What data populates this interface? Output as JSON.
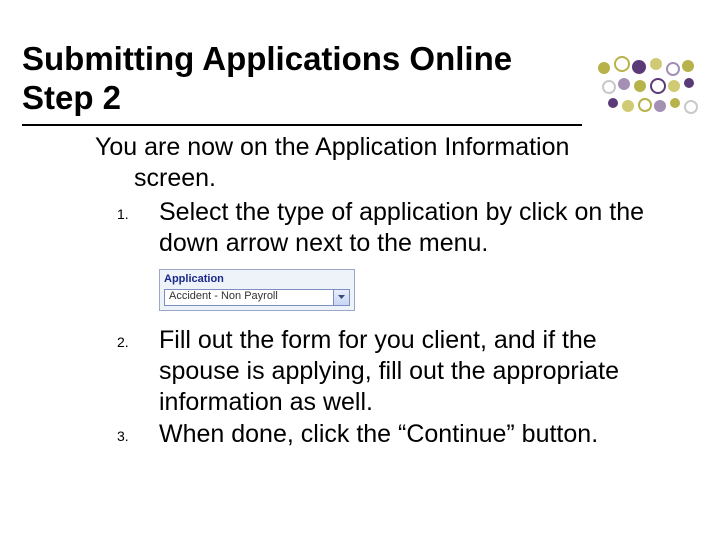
{
  "title": "Submitting Applications Online Step 2",
  "intro": "You are now on the Application Information screen.",
  "items": [
    {
      "num": "1.",
      "text": "Select the type of application by click on the down arrow next to the menu."
    },
    {
      "num": "2.",
      "text": "Fill out the form for you client, and if the spouse is applying, fill out the appropriate information as well."
    },
    {
      "num": "3.",
      "text": "When done, click the “Continue” button."
    }
  ],
  "dropdown": {
    "label": "Application",
    "value": "Accident - Non Payroll"
  },
  "decor": {
    "colors": {
      "olive": "#b8b24a",
      "olive_light": "#d0ca74",
      "purple": "#5b3a78",
      "purple_light": "#a390b3",
      "grey": "#c9c9c9"
    }
  }
}
